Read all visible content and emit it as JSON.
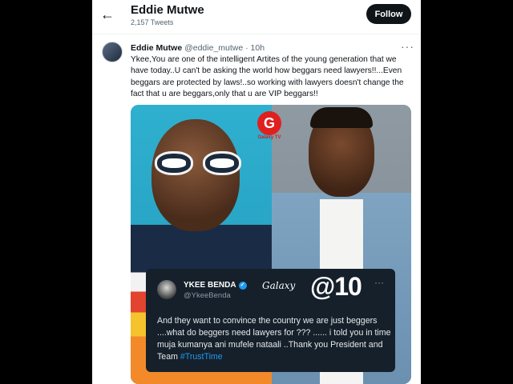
{
  "header": {
    "back_icon": "arrow-left-icon",
    "name": "Eddie Mutwe",
    "tweet_count": "2,157 Tweets",
    "follow_label": "Follow"
  },
  "tweet": {
    "author_name": "Eddie Mutwe",
    "author_handle": "@eddie_mutwe",
    "time": "· 10h",
    "more_icon": "ellipsis-icon",
    "text": "Ykee,You are one of the intelligent Artites of the young generation that we have today..U can't be asking the world how beggars need lawyers!!...Even beggars are protected by laws!..so  working with lawyers doesn't change the fact that u are beggars,only that u are VIP beggars!!"
  },
  "media": {
    "logo_letter": "G",
    "logo_text": "Galaxy TV",
    "embedded_tweet": {
      "name": "YKEE BENDA",
      "handle": "@YkeeBenda",
      "brand_word": "Galaxy",
      "brand_number": "@10",
      "text_main": "And they want to convince the country we are just beggers ....what do beggers need lawyers for ??? ...... i told you in time muja kumanya ani mufele nataali ..Thank you President and Team ",
      "hashtag": "#TrustTime"
    }
  }
}
